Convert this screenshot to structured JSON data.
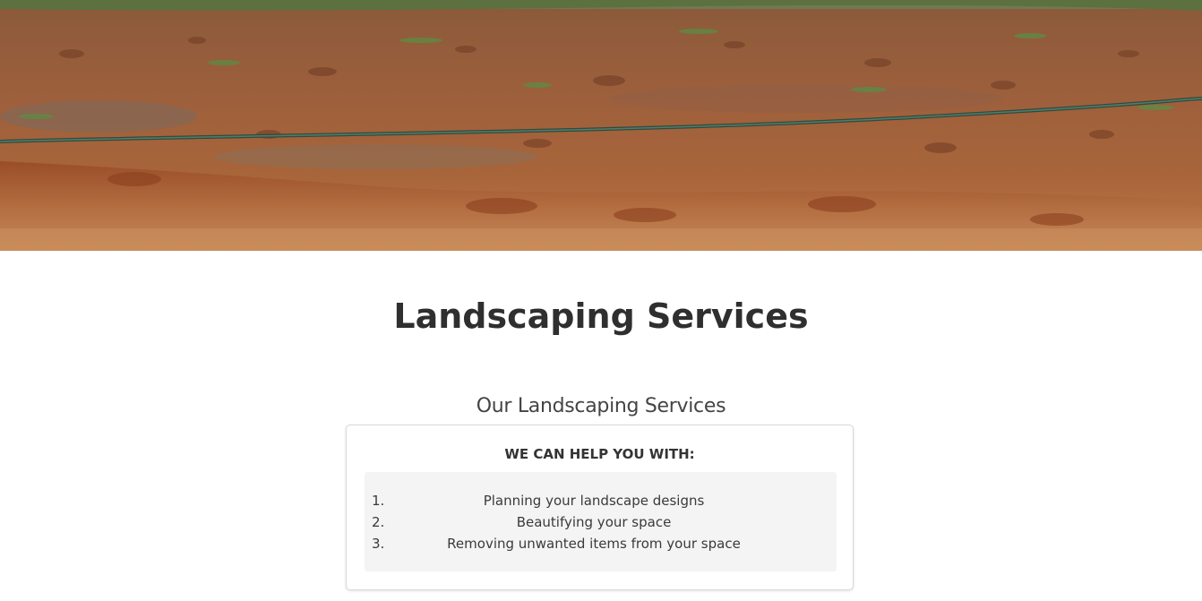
{
  "hero": {
    "image": "landscaping-soil-hero-image"
  },
  "page": {
    "title": "Landscaping Services"
  },
  "section": {
    "subtitle": "Our Landscaping Services"
  },
  "card": {
    "heading": "WE CAN HELP YOU WITH:",
    "items": [
      {
        "number": "1.",
        "text": "Planning your landscape designs"
      },
      {
        "number": "2.",
        "text": "Beautifying your space"
      },
      {
        "number": "3.",
        "text": "Removing unwanted items from your space"
      }
    ]
  },
  "colors": {
    "soil": "#b06a3c",
    "card_border": "#d9d9d9",
    "list_background": "#f4f4f4",
    "text": "#333333"
  }
}
